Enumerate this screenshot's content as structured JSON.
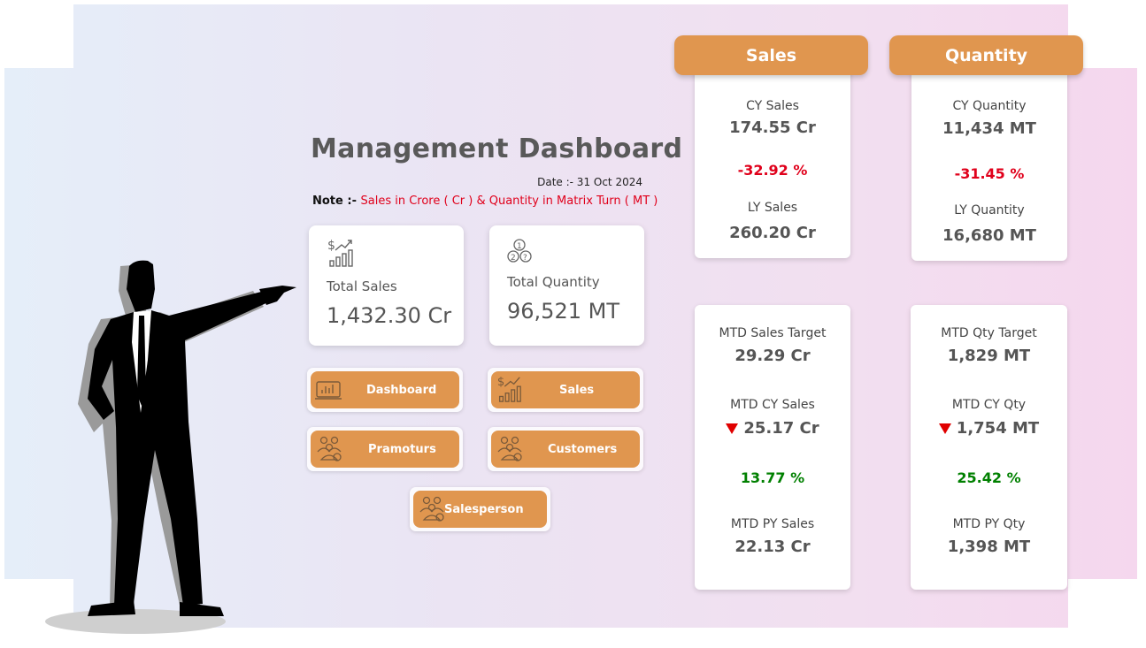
{
  "header": {
    "title": "Management Dashboard",
    "date": "Date :- 31 Oct 2024",
    "note_prefix": "Note :- ",
    "note_text": "Sales in Crore  ( Cr ) & Quantity in Matrix Turn ( MT )"
  },
  "kpis": {
    "total_sales": {
      "label": "Total Sales",
      "value": "1,432.30 Cr",
      "icon": "sales-growth-icon"
    },
    "total_quantity": {
      "label": "Total Quantity",
      "value": "96,521 MT",
      "icon": "coins-icon"
    }
  },
  "nav": {
    "dashboard": {
      "label": "Dashboard",
      "icon": "monitor-chart-icon"
    },
    "sales": {
      "label": "Sales",
      "icon": "sales-growth-icon"
    },
    "pramoturs": {
      "label": "Pramoturs",
      "icon": "group-icon"
    },
    "customers": {
      "label": "Customers",
      "icon": "group-icon"
    },
    "salesperson": {
      "label": "Salesperson",
      "icon": "group-icon"
    }
  },
  "sales_panel": {
    "header": "Sales",
    "cy_label": "CY Sales",
    "cy_value": "174.55 Cr",
    "change": "-32.92 %",
    "ly_label": "LY Sales",
    "ly_value": "260.20 Cr",
    "mtd_target_label": "MTD Sales Target",
    "mtd_target_value": "29.29 Cr",
    "mtd_cy_label": "MTD CY Sales",
    "mtd_cy_value": "25.17 Cr",
    "mtd_pct": "13.77 %",
    "mtd_py_label": "MTD PY Sales",
    "mtd_py_value": "22.13 Cr"
  },
  "quantity_panel": {
    "header": "Quantity",
    "cy_label": "CY Quantity",
    "cy_value": "11,434 MT",
    "change": "-31.45 %",
    "ly_label": "LY Quantity",
    "ly_value": "16,680 MT",
    "mtd_target_label": "MTD Qty Target",
    "mtd_target_value": "1,829 MT",
    "mtd_cy_label": "MTD CY Qty",
    "mtd_cy_value": "1,754 MT",
    "mtd_pct": "25.42 %",
    "mtd_py_label": "MTD PY Qty",
    "mtd_py_value": "1,398 MT"
  },
  "colors": {
    "accent": "#e0964f",
    "negative": "#e0001b",
    "positive": "#008000",
    "text": "#555555"
  }
}
